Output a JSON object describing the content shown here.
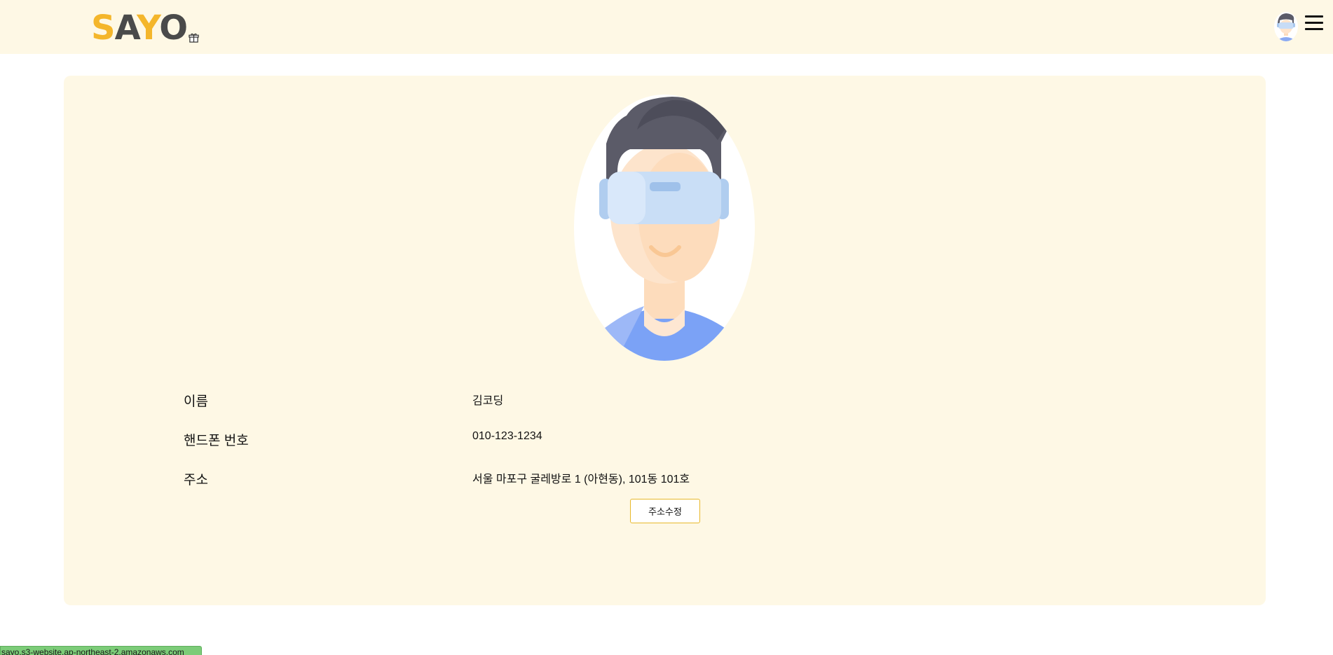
{
  "header": {
    "logo_letters": [
      "S",
      "A",
      "Y",
      "O"
    ],
    "logo_icon": "gift-icon",
    "avatar_icon": "user-avatar-icon",
    "menu_icon": "hamburger-menu-icon"
  },
  "profile": {
    "avatar_icon": "vr-headset-user-avatar",
    "fields": [
      {
        "label": "이름",
        "value": "김코딩"
      },
      {
        "label": "핸드폰 번호",
        "value": "010-123-1234"
      },
      {
        "label": "주소",
        "value": "서울 마포구 굴레방로 1 (아현동), 101동 101호"
      }
    ],
    "edit_address_button": "주소수정"
  },
  "status_bar": {
    "text": "sayo.s3-website.ap-northeast-2.amazonaws.com"
  },
  "colors": {
    "header_bg": "#fef8e5",
    "card_bg": "#fef8e5",
    "brand_yellow": "#f4b62b",
    "brand_gray": "#4a4a4a",
    "button_border": "#e8b82a",
    "status_green": "#7ccc78"
  }
}
